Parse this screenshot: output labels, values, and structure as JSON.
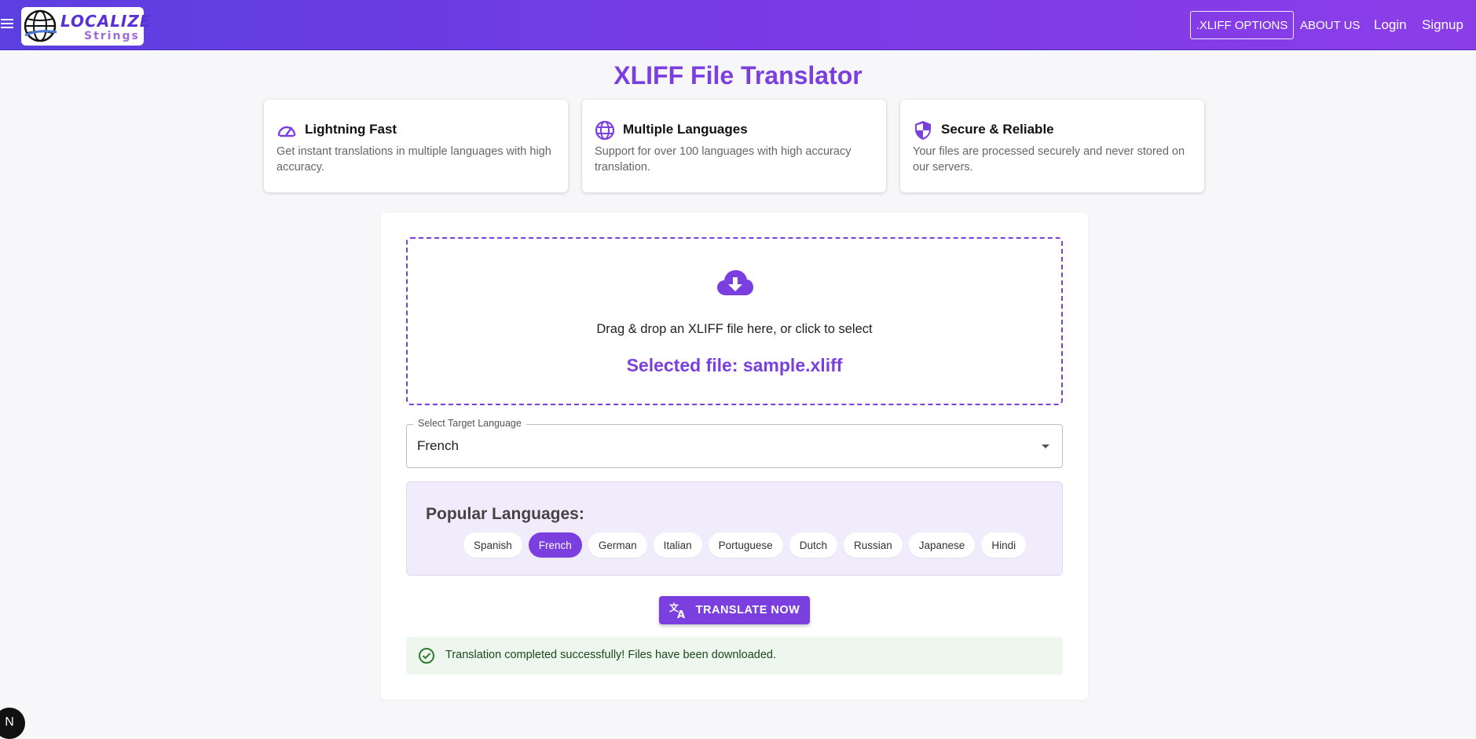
{
  "header": {
    "logo_word1": "LOCALIZE",
    "logo_word2": "Strings",
    "nav": {
      "xliff_options": ".XLIFF OPTIONS",
      "about_us": "ABOUT US",
      "login": "Login",
      "signup": "Signup"
    }
  },
  "page_title": "XLIFF File Translator",
  "features": [
    {
      "icon": "speedometer-icon",
      "title": "Lightning Fast",
      "desc": "Get instant translations in multiple languages with high accuracy."
    },
    {
      "icon": "globe-icon",
      "title": "Multiple Languages",
      "desc": "Support for over 100 languages with high accuracy translation."
    },
    {
      "icon": "shield-icon",
      "title": "Secure & Reliable",
      "desc": "Your files are processed securely and never stored on our servers."
    }
  ],
  "dropzone": {
    "icon": "cloud-download-icon",
    "instruction": "Drag & drop an XLIFF file here, or click to select",
    "selected_file": "Selected file: sample.xliff"
  },
  "target_language": {
    "label": "Select Target Language",
    "value": "French"
  },
  "popular": {
    "title": "Popular Languages:",
    "languages": [
      "Spanish",
      "French",
      "German",
      "Italian",
      "Portuguese",
      "Dutch",
      "Russian",
      "Japanese",
      "Hindi"
    ],
    "selected": "French"
  },
  "translate_button": "TRANSLATE NOW",
  "alert": {
    "type": "success",
    "message": "Translation completed successfully! Files have been downloaded."
  },
  "dev_badge": "N",
  "colors": {
    "accent": "#7b3fe0",
    "header_start": "#5b3fe0",
    "header_end": "#8b3ee8",
    "success_bg": "#edf7ed"
  }
}
